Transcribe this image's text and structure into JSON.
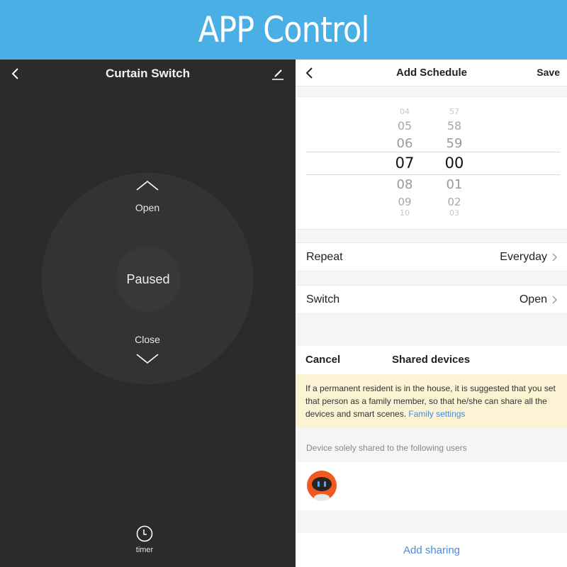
{
  "banner": {
    "title": "APP Control",
    "color": "#4aafe4"
  },
  "curtain": {
    "title": "Curtain Switch",
    "back_icon": "chevron-left-icon",
    "edit_icon": "pencil-icon",
    "open_label": "Open",
    "close_label": "Close",
    "status": "Paused",
    "timer_label": "timer",
    "timer_icon": "clock-icon"
  },
  "schedule": {
    "title": "Add Schedule",
    "save_label": "Save",
    "back_icon": "chevron-left-icon",
    "hours": [
      "04",
      "05",
      "06",
      "07",
      "08",
      "09",
      "10"
    ],
    "minutes": [
      "57",
      "58",
      "59",
      "00",
      "01",
      "02",
      "03"
    ],
    "selected_hour": "07",
    "selected_minute": "00",
    "rows": [
      {
        "label": "Repeat",
        "value": "Everyday"
      },
      {
        "label": "Switch",
        "value": "Open"
      }
    ]
  },
  "sharing": {
    "cancel_label": "Cancel",
    "title": "Shared devices",
    "notice_text": "If a permanent resident is in the house, it is suggested that you set that person as a family member, so that he/she can share all the devices and smart scenes. ",
    "notice_link": "Family settings",
    "notice_bg": "#fcf3d4",
    "link_color": "#3c8ee0",
    "users_label": "Device solely shared to the following users",
    "user_avatar": "robot-avatar-icon",
    "add_label": "Add sharing"
  }
}
